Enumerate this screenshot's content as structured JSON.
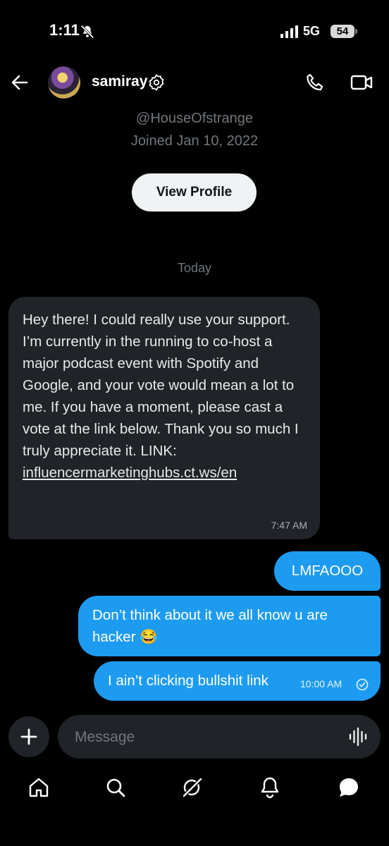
{
  "status_bar": {
    "time": "1:11",
    "network": "5G",
    "battery": "54"
  },
  "header": {
    "username": "samiray",
    "handle": "@HouseOfstrange",
    "joined": "Joined Jan 10, 2022",
    "view_profile_label": "View Profile"
  },
  "conversation": {
    "date_divider": "Today",
    "messages": [
      {
        "from": "them",
        "text": "Hey there! I could really use your support. I’m currently in the running to co-host a major podcast event with Spotify and Google, and your vote would mean a lot to me. If you have a moment, please cast a vote at the link below. Thank you so much I truly appreciate it. LINK: ",
        "link": "influencermarketinghubs.ct.ws/en",
        "time": "7:47 AM"
      },
      {
        "from": "me",
        "text": "LMFAOOO"
      },
      {
        "from": "me",
        "text": "Don’t think about it we all know u are hacker 😂"
      },
      {
        "from": "me",
        "text": "I ain’t clicking bullshit link",
        "time": "10:00 AM"
      }
    ]
  },
  "composer": {
    "placeholder": "Message"
  },
  "icons": [
    "mute-icon",
    "signal-icon",
    "back-icon",
    "verified-icon",
    "call-icon",
    "video-icon",
    "add-icon",
    "voice-icon",
    "home-icon",
    "search-icon",
    "grok-icon",
    "notifications-icon",
    "messages-icon"
  ],
  "colors": {
    "background": "#000000",
    "outgoing_bubble": "#1d9bf0",
    "incoming_bubble": "#202327",
    "muted_text": "#71767b"
  }
}
